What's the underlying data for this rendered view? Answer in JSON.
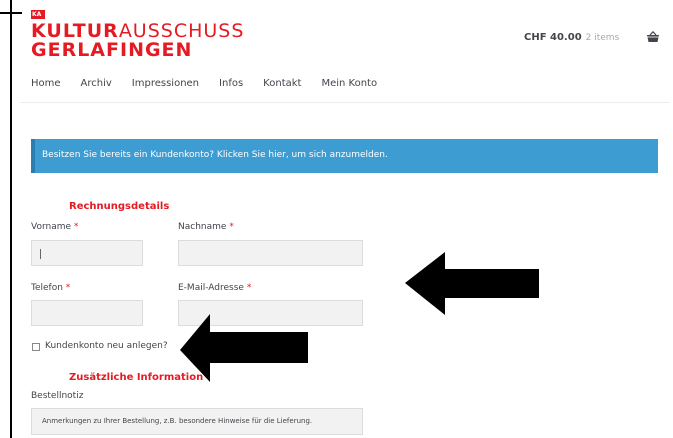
{
  "brand": {
    "badge": "KA",
    "line1_bold": "KULTUR",
    "line1_light": "AUSSCHUSS",
    "line2": "GERLAFINGEN"
  },
  "cart": {
    "amount": "CHF 40.00",
    "items": "2 items",
    "icon": "basket-icon"
  },
  "nav": [
    "Home",
    "Archiv",
    "Impressionen",
    "Infos",
    "Kontakt",
    "Mein Konto"
  ],
  "notice": {
    "text": "Besitzen Sie bereits ein Kundenkonto? Klicken Sie hier, um sich anzumelden."
  },
  "billing": {
    "title": "Rechnungsdetails",
    "first_name_label": "Vorname",
    "last_name_label": "Nachname",
    "phone_label": "Telefon",
    "email_label": "E-Mail-Adresse",
    "required_mark": "*",
    "create_account_label": "Kundenkonto neu anlegen?"
  },
  "additional": {
    "title": "Zusätzliche Information",
    "order_note_label": "Bestellnotiz",
    "order_note_placeholder": "Anmerkungen zu Ihrer Bestellung, z.B. besondere Hinweise für die Lieferung."
  },
  "colors": {
    "brand_red": "#e41b23",
    "notice_blue": "#3d9cd2",
    "arrow": "#000000"
  }
}
